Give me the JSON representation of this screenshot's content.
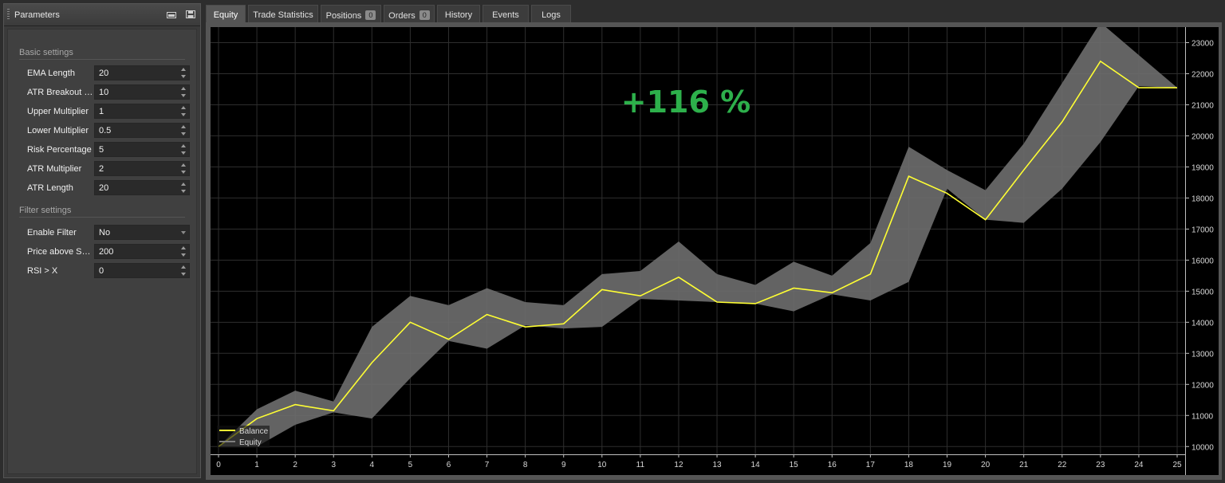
{
  "params": {
    "title": "Parameters",
    "sections": [
      {
        "title": "Basic settings",
        "fields": [
          {
            "label": "EMA Length",
            "value": "20",
            "kind": "spin"
          },
          {
            "label": "ATR Breakout Period",
            "value": "10",
            "kind": "spin"
          },
          {
            "label": "Upper Multiplier",
            "value": "1",
            "kind": "spin"
          },
          {
            "label": "Lower Multiplier",
            "value": "0.5",
            "kind": "spin"
          },
          {
            "label": "Risk Percentage",
            "value": "5",
            "kind": "spin"
          },
          {
            "label": "ATR Multiplier",
            "value": "2",
            "kind": "spin"
          },
          {
            "label": "ATR Length",
            "value": "20",
            "kind": "spin"
          }
        ]
      },
      {
        "title": "Filter settings",
        "fields": [
          {
            "label": "Enable Filter",
            "value": "No",
            "kind": "dropdown"
          },
          {
            "label": "Price above SMA",
            "value": "200",
            "kind": "spin"
          },
          {
            "label": "RSI > X",
            "value": "0",
            "kind": "spin"
          }
        ]
      }
    ]
  },
  "tabs": [
    {
      "label": "Equity",
      "active": true
    },
    {
      "label": "Trade Statistics"
    },
    {
      "label": "Positions",
      "badge": "0"
    },
    {
      "label": "Orders",
      "badge": "0"
    },
    {
      "label": "History"
    },
    {
      "label": "Events"
    },
    {
      "label": "Logs"
    }
  ],
  "chart_data": {
    "type": "line",
    "headline": "+116 %",
    "x": [
      0,
      1,
      2,
      3,
      4,
      5,
      6,
      7,
      8,
      9,
      10,
      11,
      12,
      13,
      14,
      15,
      16,
      17,
      18,
      19,
      20,
      21,
      22,
      23,
      24,
      25
    ],
    "xlim": [
      0,
      25
    ],
    "ylim": [
      9750,
      23500
    ],
    "yticks": [
      10000,
      11000,
      12000,
      13000,
      14000,
      15000,
      16000,
      17000,
      18000,
      19000,
      20000,
      21000,
      22000,
      23000
    ],
    "legend_position": "bottom-left",
    "grid": true,
    "series": [
      {
        "name": "Balance",
        "color": "#ffff33",
        "values": [
          10000,
          10900,
          11350,
          11150,
          12700,
          14000,
          13450,
          14250,
          13850,
          13950,
          15050,
          14850,
          15450,
          14650,
          14600,
          15100,
          14950,
          15550,
          18700,
          18150,
          17300,
          18900,
          20450,
          22400,
          21550,
          21550
        ]
      },
      {
        "name": "Equity",
        "color": "#808080",
        "upper": [
          10000,
          11200,
          11800,
          11450,
          13850,
          14850,
          14550,
          15100,
          14650,
          14550,
          15550,
          15650,
          16600,
          15550,
          15200,
          15950,
          15500,
          16550,
          19650,
          18900,
          18250,
          19750,
          21700,
          23650,
          22600,
          21550
        ],
        "lower": [
          10000,
          10000,
          10700,
          11100,
          10900,
          12200,
          13400,
          13150,
          13900,
          13800,
          13850,
          14750,
          14700,
          14650,
          14600,
          14350,
          14900,
          14700,
          15300,
          18300,
          17300,
          17200,
          18300,
          19800,
          21600,
          21550
        ]
      }
    ],
    "colors": {
      "background": "#000000",
      "band": "#6e6e6e",
      "headline": "#2db04b"
    }
  }
}
